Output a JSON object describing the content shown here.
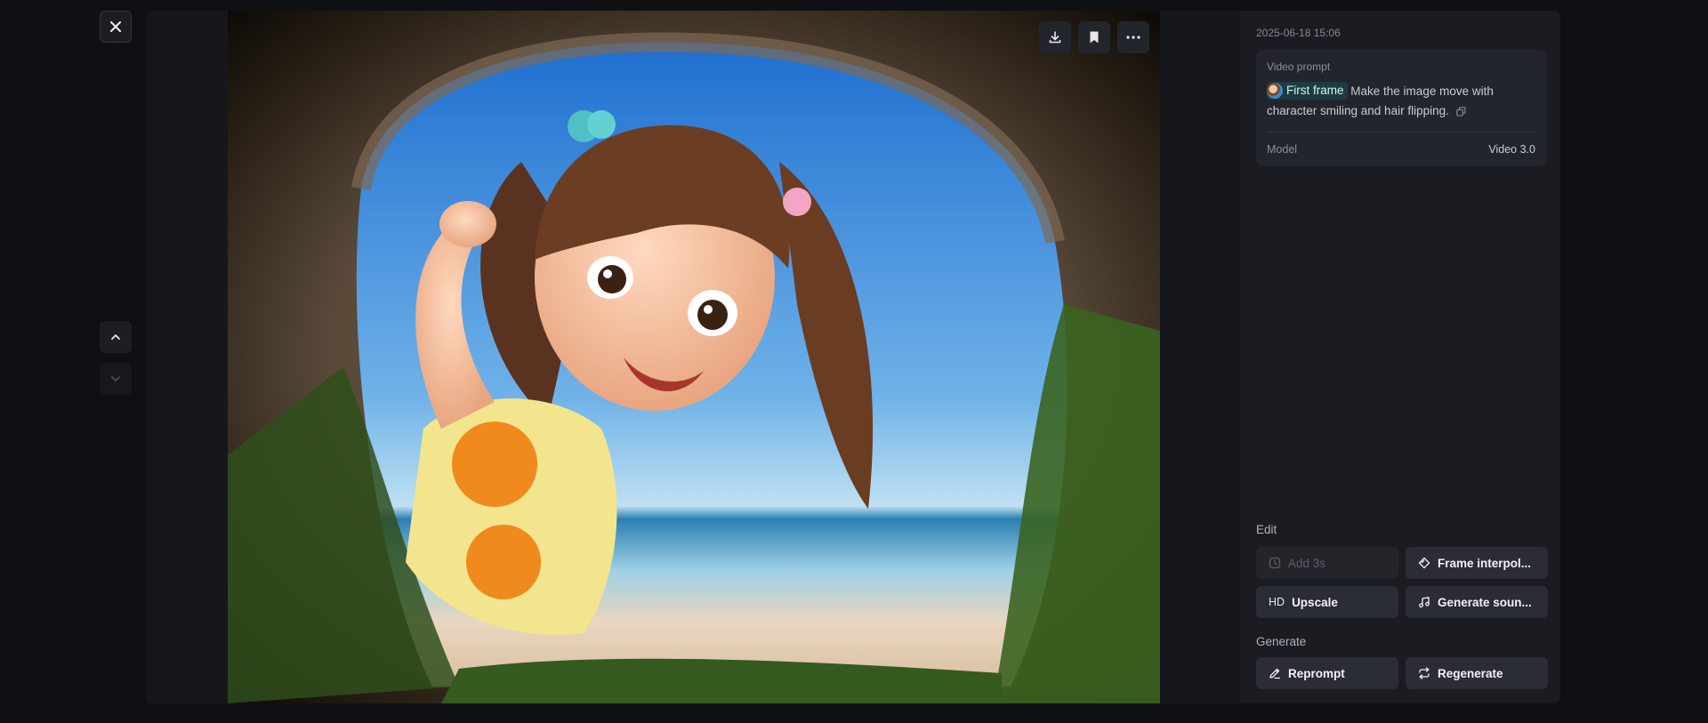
{
  "viewer": {
    "close_icon": "close-icon",
    "prev_icon": "chevron-up-icon",
    "next_icon": "chevron-down-icon"
  },
  "media": {
    "tools": [
      {
        "name": "download-icon"
      },
      {
        "name": "bookmark-icon"
      },
      {
        "name": "more-icon"
      }
    ]
  },
  "panel": {
    "timestamp": "2025-06-18 15:06",
    "prompt_card": {
      "label": "Video prompt",
      "chip_label": "First frame",
      "prompt_text": "Make the image move with character smiling and hair flipping.",
      "model_key": "Model",
      "model_value": "Video 3.0"
    },
    "edit": {
      "title": "Edit",
      "add3s": "Add 3s",
      "frame_interp": "Frame interpol...",
      "upscale_prefix": "HD",
      "upscale": "Upscale",
      "generate_sound": "Generate soun..."
    },
    "generate": {
      "title": "Generate",
      "reprompt": "Reprompt",
      "regenerate": "Regenerate"
    }
  },
  "colors": {
    "background": "#0f1014",
    "panel": "#1a1c22",
    "card": "#23252c",
    "button": "#2a2d35",
    "chip": "#1e3b44",
    "sky": "#3d8ad6"
  }
}
